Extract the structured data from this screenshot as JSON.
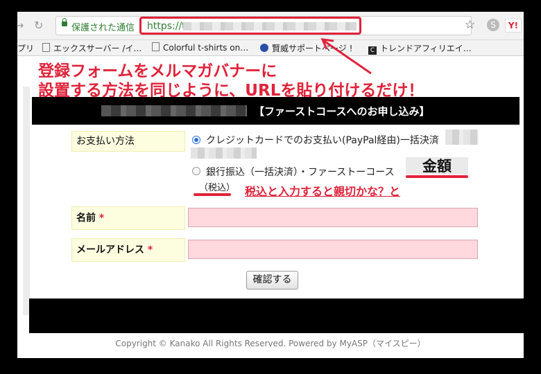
{
  "browser": {
    "secure_label": "保護された通信",
    "url_prefix": "https://t",
    "ext_skype": "S",
    "ext_yahoo": "Y!",
    "bookmarks": [
      {
        "label": "プリ"
      },
      {
        "label": "エックスサーバー /イ…"
      },
      {
        "label": "Colorful t-shirts on…"
      },
      {
        "label": "賢威サポートページ !"
      },
      {
        "label": "トレンドアフィリエイ…"
      }
    ]
  },
  "annotation": {
    "line1": "登録フォームをメルマガバナーに",
    "line2": "設置する方法を同じように、URLを貼り付けるだけ！",
    "kingaku": "金額",
    "tax_note": "税込と入力すると親切かな？と"
  },
  "form": {
    "header_title": "【ファーストコースへのお申し込み】",
    "payment_label": "お支払い方法",
    "option_paypal": "クレジットカードでのお支払い(PayPal経由)一括決済",
    "option_bank": "銀行振込（一括決済）・ファーストーコース",
    "tax_included": "（税込）",
    "name_label": "名前",
    "email_label": "メールアドレス",
    "required_mark": "*",
    "confirm_button": "確認する",
    "name_value": "",
    "email_value": ""
  },
  "footer": {
    "copyright": "Copyright © Kanako All Rights Reserved. Powered by MyASP（マイスピー）"
  },
  "colors": {
    "annotation_red": "#e0223a",
    "secure_green": "#2e7d32",
    "label_bg": "#fdfde0",
    "field_bg": "#ffd9dd"
  }
}
